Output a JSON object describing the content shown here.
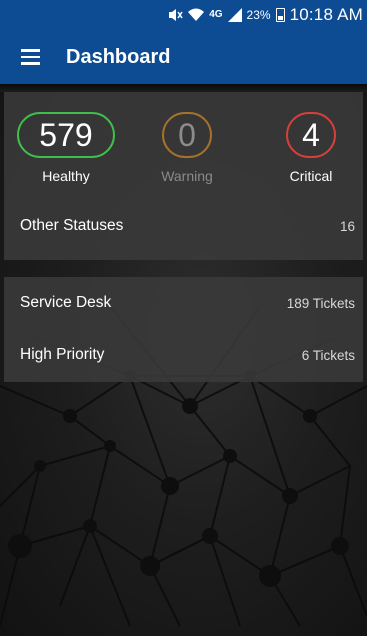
{
  "status_bar": {
    "network_label": "4G",
    "battery": "23%",
    "time": "10:18 AM"
  },
  "app_bar": {
    "title": "Dashboard"
  },
  "status_summary": {
    "healthy": {
      "count": "579",
      "label": "Healthy",
      "color": "#3fbf4a"
    },
    "warning": {
      "count": "0",
      "label": "Warning",
      "color": "#a5722b"
    },
    "critical": {
      "count": "4",
      "label": "Critical",
      "color": "#d6403a"
    },
    "other": {
      "label": "Other Statuses",
      "value": "16"
    }
  },
  "tickets": {
    "service_desk": {
      "label": "Service Desk",
      "value": "189 Tickets"
    },
    "high_priority": {
      "label": "High Priority",
      "value": "6 Tickets"
    }
  },
  "theme": {
    "primary": "#0d4c93"
  }
}
